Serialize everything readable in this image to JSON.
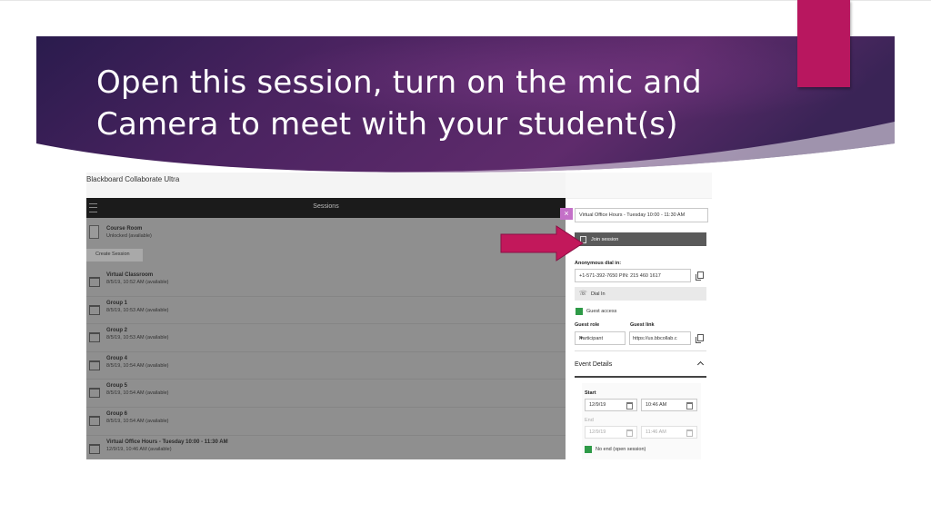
{
  "slide": {
    "title": "Open this session, turn on the mic and Camera to meet with your student(s)",
    "colors": {
      "banner_dark": "#2a1c4a",
      "banner_purple": "#5e2b6b",
      "accent_pink": "#b8175f",
      "arrow": "#c2185b"
    }
  },
  "app": {
    "window_title": "Blackboard Collaborate Ultra",
    "sessions_header": "Sessions",
    "course_room": {
      "name": "Course Room",
      "status": "Unlocked (available)"
    },
    "create_session_label": "Create Session",
    "sessions": [
      {
        "name": "Virtual Classroom",
        "time": "8/5/19, 10:52 AM (available)"
      },
      {
        "name": "Group 1",
        "time": "8/5/19, 10:53 AM (available)"
      },
      {
        "name": "Group 2",
        "time": "8/5/19, 10:53 AM (available)"
      },
      {
        "name": "Group 4",
        "time": "8/5/19, 10:54 AM (available)"
      },
      {
        "name": "Group 5",
        "time": "8/5/19, 10:54 AM (available)"
      },
      {
        "name": "Group 6",
        "time": "8/5/19, 10:54 AM (available)"
      },
      {
        "name": "Virtual Office Hours - Tuesday 10:00 - 11:30 AM",
        "time": "12/9/19, 10:46 AM (available)"
      }
    ]
  },
  "panel": {
    "close_icon": "×",
    "session_name": "Virtual Office Hours - Tuesday 10:00 - 11:30 AM",
    "join_label": "Join session",
    "dial_in_label": "Anonymous dial in:",
    "dial_in_value": "+1-571-392-7650 PIN: 215 460 1617",
    "dial_in_button": "Dial In",
    "guest_access_label": "Guest access",
    "guest_role_label": "Guest role",
    "guest_role_value": "Participant",
    "guest_link_label": "Guest link",
    "guest_link_value": "https://us.bbcollab.c",
    "event_details_label": "Event Details",
    "start_label": "Start",
    "start_date": "12/9/19",
    "start_time": "10:46 AM",
    "end_label": "End",
    "end_date": "12/9/19",
    "end_time": "11:46 AM",
    "no_end_label": "No end (open session)"
  }
}
